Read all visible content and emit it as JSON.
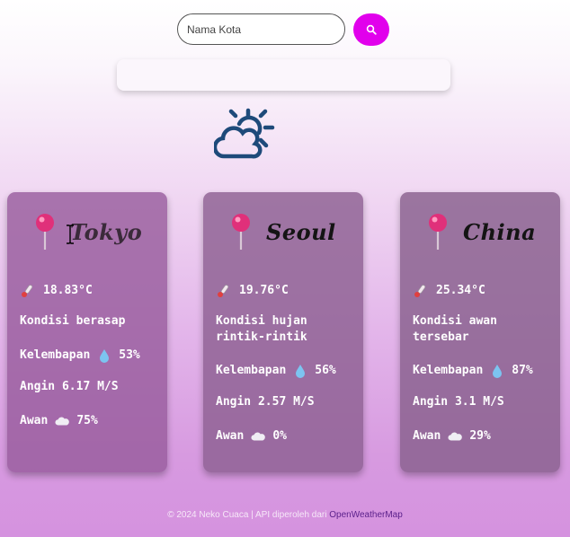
{
  "search": {
    "placeholder": "Nama Kota"
  },
  "cards": [
    {
      "city": "Tokyo",
      "temperature": "18.83°C",
      "condition": "Kondisi berasap",
      "humidity_label": "Kelembapan",
      "humidity": "53%",
      "wind": "Angin 6.17 M/S",
      "cloud_label": "Awan",
      "cloud": "75%"
    },
    {
      "city": "Seoul",
      "temperature": "19.76°C",
      "condition": "Kondisi hujan rintik-rintik",
      "humidity_label": "Kelembapan",
      "humidity": "56%",
      "wind": "Angin 2.57 M/S",
      "cloud_label": "Awan",
      "cloud": "0%"
    },
    {
      "city": "China",
      "temperature": "25.34°C",
      "condition": "Kondisi awan tersebar",
      "humidity_label": "Kelembapan",
      "humidity": "87%",
      "wind": "Angin 3.1 M/S",
      "cloud_label": "Awan",
      "cloud": "29%"
    }
  ],
  "footer": {
    "text": "© 2024 Neko Cuaca | API diperoleh dari",
    "link": "OpenWeatherMap"
  },
  "colors": {
    "accent": "#e100ec",
    "hero_icon": "#1e4a7a",
    "pin": "#e0307a"
  },
  "icons": {
    "search": "search-icon",
    "hero": "sun-cloud-icon",
    "pin": "pushpin-icon",
    "temperature": "thermometer-icon",
    "humidity": "droplet-icon",
    "cloud": "cloud-icon"
  }
}
